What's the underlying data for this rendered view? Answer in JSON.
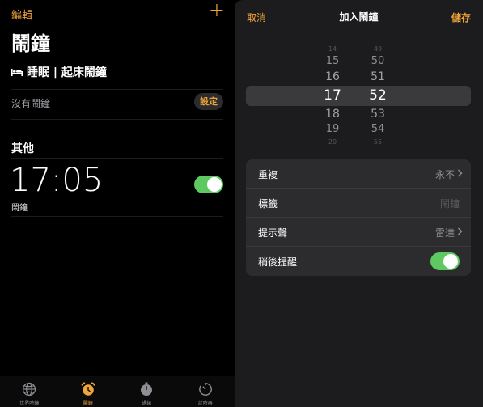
{
  "left": {
    "edit_label": "編輯",
    "add_label": "+",
    "title": "鬧鐘",
    "sleep_section": "睡眠 | 起床鬧鐘",
    "no_alarm_text": "沒有鬧鐘",
    "set_button": "設定",
    "other_section": "其他",
    "alarm": {
      "time": "17:05",
      "label": "鬧鐘",
      "enabled": true
    }
  },
  "tabbar": {
    "items": [
      {
        "label": "世界時鐘",
        "icon": "globe-icon",
        "active": false
      },
      {
        "label": "鬧鐘",
        "icon": "alarm-clock-icon",
        "active": true
      },
      {
        "label": "碼錶",
        "icon": "stopwatch-icon",
        "active": false
      },
      {
        "label": "計時器",
        "icon": "timer-icon",
        "active": false
      }
    ]
  },
  "sheet": {
    "cancel": "取消",
    "title": "加入鬧鐘",
    "save": "儲存",
    "picker": {
      "hours": [
        "14",
        "15",
        "16",
        "17",
        "18",
        "19",
        "20"
      ],
      "minutes": [
        "49",
        "50",
        "51",
        "52",
        "53",
        "54",
        "55"
      ],
      "selected_hour": "17",
      "selected_minute": "52"
    },
    "settings": {
      "repeat": {
        "label": "重複",
        "value": "永不"
      },
      "tag": {
        "label": "標籤",
        "placeholder": "鬧鐘"
      },
      "sound": {
        "label": "提示聲",
        "value": "雷達"
      },
      "snooze": {
        "label": "稍後提醒",
        "enabled": true
      }
    }
  },
  "colors": {
    "accent": "#f0a53a",
    "toggle_on": "#5fc961"
  }
}
